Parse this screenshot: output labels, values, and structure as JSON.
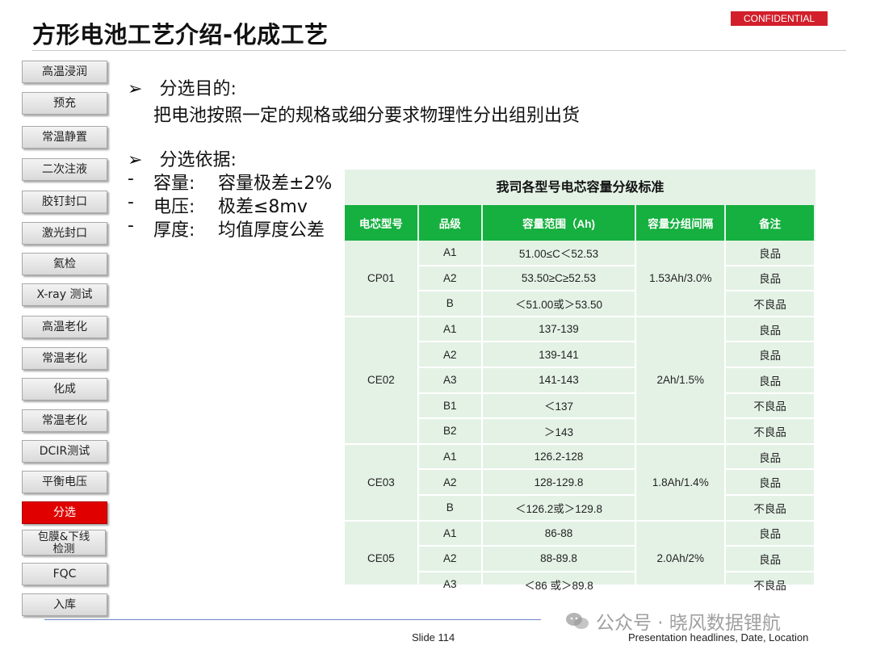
{
  "header": {
    "title": "方形电池工艺介绍-化成工艺",
    "badge": "CONFIDENTIAL"
  },
  "sidebar": {
    "items": [
      {
        "label": "高温浸润"
      },
      {
        "label": "预充"
      },
      {
        "label": "常温静置"
      },
      {
        "label": "二次注液"
      },
      {
        "label": "胶钉封口"
      },
      {
        "label": "激光封口"
      },
      {
        "label": "氦检"
      },
      {
        "label": "X-ray 测试"
      },
      {
        "label": "高温老化"
      },
      {
        "label": "常温老化"
      },
      {
        "label": "化成"
      },
      {
        "label": "常温老化"
      },
      {
        "label": "DCIR测试"
      },
      {
        "label": "平衡电压"
      },
      {
        "label": "分选",
        "active": true
      },
      {
        "label_line1": "包膜&下线",
        "label_line2": "检测"
      },
      {
        "label": "FQC"
      },
      {
        "label": "入库"
      }
    ]
  },
  "content": {
    "purpose_heading": "分选目的:",
    "purpose_text": "把电池按照一定的规格或细分要求物理性分出组别出货",
    "basis_heading": "分选依据:",
    "basis_items": [
      {
        "name": "容量:",
        "value": "容量极差±2%"
      },
      {
        "name": "电压:",
        "value": "极差≤8mv"
      },
      {
        "name": "厚度:",
        "value": "均值厚度公差"
      }
    ],
    "bullet_marker": "➢",
    "dash_marker": "-"
  },
  "table": {
    "title": "我司各型号电芯容量分级标准",
    "headers": [
      "电芯型号",
      "品级",
      "容量范围（Ah)",
      "容量分组间隔",
      "备注"
    ],
    "groups": [
      {
        "model": "CP01",
        "interval": "1.53Ah/3.0%",
        "rows": [
          {
            "grade": "A1",
            "range": "51.00≤C＜52.53",
            "note": "良品"
          },
          {
            "grade": "A2",
            "range": "53.50≥C≥52.53",
            "note": "良品"
          },
          {
            "grade": "B",
            "range": "＜51.00或＞53.50",
            "note": "不良品"
          }
        ]
      },
      {
        "model": "CE02",
        "interval": "2Ah/1.5%",
        "rows": [
          {
            "grade": "A1",
            "range": "137-139",
            "note": "良品"
          },
          {
            "grade": "A2",
            "range": "139-141",
            "note": "良品"
          },
          {
            "grade": "A3",
            "range": "141-143",
            "note": "良品"
          },
          {
            "grade": "B1",
            "range": "＜137",
            "note": "不良品"
          },
          {
            "grade": "B2",
            "range": "＞143",
            "note": "不良品"
          }
        ]
      },
      {
        "model": "CE03",
        "interval": "1.8Ah/1.4%",
        "rows": [
          {
            "grade": "A1",
            "range": "126.2-128",
            "note": "良品"
          },
          {
            "grade": "A2",
            "range": "128-129.8",
            "note": "良品"
          },
          {
            "grade": "B",
            "range": "＜126.2或＞129.8",
            "note": "不良品"
          }
        ]
      },
      {
        "model": "CE05",
        "interval": "2.0Ah/2%",
        "rows": [
          {
            "grade": "A1",
            "range": "86-88",
            "note": "良品"
          },
          {
            "grade": "A2",
            "range": "88-89.8",
            "note": "良品"
          },
          {
            "grade": "A3",
            "range": "＜86 或＞89.8",
            "note": "不良品"
          }
        ]
      }
    ]
  },
  "footer": {
    "slide": "Slide 114",
    "info": "Presentation headlines, Date, Location",
    "watermark": "公众号 · 晓风数据锂航"
  },
  "colors": {
    "header_green": "#15b03f",
    "table_bg": "#e4f2e6",
    "active_red": "#e00000",
    "confidential_red": "#d21f2b"
  }
}
